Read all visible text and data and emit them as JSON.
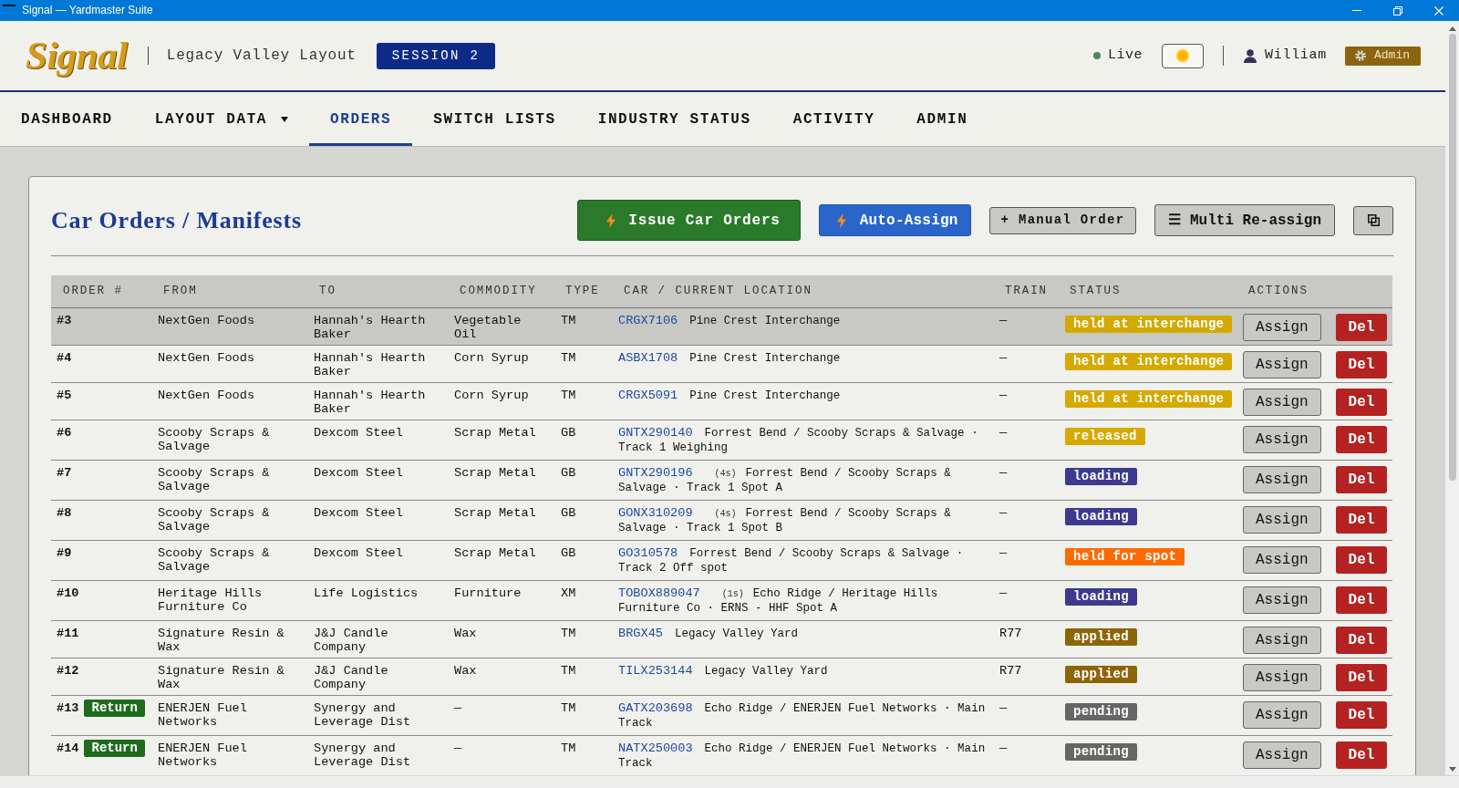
{
  "window": {
    "title": "Signal — Yardmaster Suite"
  },
  "header": {
    "logo": "Signal",
    "layout": "Legacy Valley Layout",
    "session": "SESSION 2",
    "status": "Live",
    "user": "William",
    "role": "Admin"
  },
  "nav": [
    {
      "label": "DASHBOARD",
      "selected": false,
      "dropdown": false
    },
    {
      "label": "LAYOUT DATA",
      "selected": false,
      "dropdown": true
    },
    {
      "label": "ORDERS",
      "selected": true,
      "dropdown": false
    },
    {
      "label": "SWITCH LISTS",
      "selected": false,
      "dropdown": false
    },
    {
      "label": "INDUSTRY STATUS",
      "selected": false,
      "dropdown": false
    },
    {
      "label": "ACTIVITY",
      "selected": false,
      "dropdown": false
    },
    {
      "label": "ADMIN",
      "selected": false,
      "dropdown": false
    }
  ],
  "panel": {
    "title": "Car Orders / Manifests",
    "actions": [
      {
        "kind": "primary",
        "label": "Issue Car Orders"
      },
      {
        "kind": "accent",
        "label": "Auto-Assign"
      },
      {
        "kind": "plain",
        "label": "+ Manual Order"
      },
      {
        "kind": "menu",
        "label": "☰ Multi Re-assign"
      },
      {
        "kind": "icon"
      }
    ]
  },
  "table": {
    "columns": [
      "ORDER #",
      "FROM",
      "TO",
      "COMMODITY",
      "TYPE",
      "CAR / CURRENT LOCATION",
      "TRAIN",
      "STATUS",
      "ACTIONS"
    ],
    "rows": [
      {
        "order": "#3",
        "selected": true,
        "from": "NextGen Foods",
        "to": "Hannah's Hearth Baker",
        "commodity": "Vegetable Oil",
        "type": "TM",
        "car": "CRGX7106",
        "location": "Pine Crest Interchange",
        "train": "—",
        "status": {
          "label": "held at interchange",
          "color": "#d4a900"
        },
        "assign": "Assign",
        "delete": "Del"
      },
      {
        "order": "#4",
        "selected": false,
        "from": "NextGen Foods",
        "to": "Hannah's Hearth Baker",
        "commodity": "Corn Syrup",
        "type": "TM",
        "car": "ASBX1708",
        "location": "Pine Crest Interchange",
        "train": "—",
        "status": {
          "label": "held at interchange",
          "color": "#d4a900"
        },
        "assign": "Assign",
        "delete": "Del"
      },
      {
        "order": "#5",
        "selected": false,
        "from": "NextGen Foods",
        "to": "Hannah's Hearth Baker",
        "commodity": "Corn Syrup",
        "type": "TM",
        "car": "CRGX5091",
        "location": "Pine Crest Interchange",
        "train": "—",
        "status": {
          "label": "held at interchange",
          "color": "#d4a900"
        },
        "assign": "Assign",
        "delete": "Del"
      },
      {
        "order": "#6",
        "selected": false,
        "from": "Scooby Scraps & Salvage",
        "to": "Dexcom Steel",
        "commodity": "Scrap Metal",
        "type": "GB",
        "car": "GNTX290140",
        "location": "Forrest Bend / Scooby Scraps & Salvage · Track 1 Weighing",
        "train": "—",
        "status": {
          "label": "released",
          "color": "#d4a900"
        },
        "assign": "Assign",
        "delete": "Del"
      },
      {
        "order": "#7",
        "selected": false,
        "from": "Scooby Scraps & Salvage",
        "to": "Dexcom Steel",
        "commodity": "Scrap Metal",
        "type": "GB",
        "car": "GNTX290196",
        "count": "(4s)",
        "location": "Forrest Bend / Scooby Scraps & Salvage · Track 1 Spot A",
        "train": "—",
        "status": {
          "label": "loading",
          "color": "#3b3a8e"
        },
        "assign": "Assign",
        "delete": "Del"
      },
      {
        "order": "#8",
        "selected": false,
        "from": "Scooby Scraps & Salvage",
        "to": "Dexcom Steel",
        "commodity": "Scrap Metal",
        "type": "GB",
        "car": "GONX310209",
        "count": "(4s)",
        "location": "Forrest Bend / Scooby Scraps & Salvage · Track 1 Spot B",
        "train": "—",
        "status": {
          "label": "loading",
          "color": "#3b3a8e"
        },
        "assign": "Assign",
        "delete": "Del"
      },
      {
        "order": "#9",
        "selected": false,
        "from": "Scooby Scraps & Salvage",
        "to": "Dexcom Steel",
        "commodity": "Scrap Metal",
        "type": "GB",
        "car": "GO310578",
        "location": "Forrest Bend / Scooby Scraps & Salvage · Track 2 Off spot",
        "train": "—",
        "status": {
          "label": "held for spot",
          "color": "#ff6a00"
        },
        "assign": "Assign",
        "delete": "Del"
      },
      {
        "order": "#10",
        "selected": false,
        "from": "Heritage Hills Furniture Co",
        "to": "Life Logistics",
        "commodity": "Furniture",
        "type": "XM",
        "car": "TOBOX889047",
        "count": "(1s)",
        "location": "Echo Ridge / Heritage Hills Furniture Co · ERNS - HHF Spot A",
        "train": "—",
        "status": {
          "label": "loading",
          "color": "#3b3a8e"
        },
        "assign": "Assign",
        "delete": "Del"
      },
      {
        "order": "#11",
        "selected": false,
        "from": "Signature Resin & Wax",
        "to": "J&J Candle Company",
        "commodity": "Wax",
        "type": "TM",
        "car": "BRGX45",
        "location": "Legacy Valley Yard",
        "train": "R77",
        "status": {
          "label": "applied",
          "color": "#8b6508"
        },
        "assign": "Assign",
        "delete": "Del"
      },
      {
        "order": "#12",
        "selected": false,
        "from": "Signature Resin & Wax",
        "to": "J&J Candle Company",
        "commodity": "Wax",
        "type": "TM",
        "car": "TILX253144",
        "location": "Legacy Valley Yard",
        "train": "R77",
        "status": {
          "label": "applied",
          "color": "#8b6508"
        },
        "assign": "Assign",
        "delete": "Del"
      },
      {
        "order": "#13",
        "tag": "Return",
        "selected": false,
        "from": "ENERJEN Fuel Networks",
        "to": "Synergy and Leverage Dist",
        "commodity": "—",
        "type": "TM",
        "car": "GATX203698",
        "location": "Echo Ridge / ENERJEN Fuel Networks · Main Track",
        "train": "—",
        "status": {
          "label": "pending",
          "color": "#666666"
        },
        "assign": "Assign",
        "delete": "Del"
      },
      {
        "order": "#14",
        "tag": "Return",
        "selected": false,
        "from": "ENERJEN Fuel Networks",
        "to": "Synergy and Leverage Dist",
        "commodity": "—",
        "type": "TM",
        "car": "NATX250003",
        "location": "Echo Ridge / ENERJEN Fuel Networks · Main Track",
        "train": "—",
        "status": {
          "label": "pending",
          "color": "#666666"
        },
        "assign": "Assign",
        "delete": "Del"
      }
    ]
  }
}
